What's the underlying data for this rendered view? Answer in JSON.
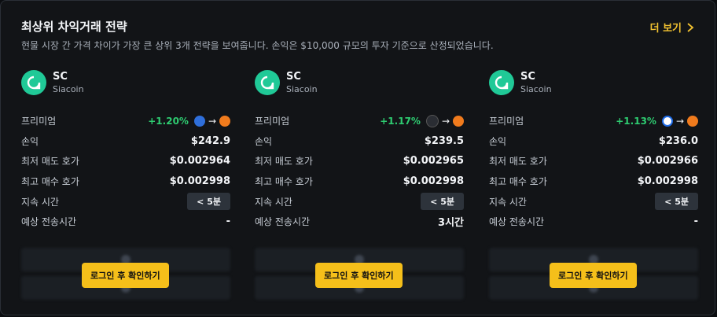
{
  "header": {
    "title": "최상위 차익거래 전략",
    "subtitle": "현물 시장 간 가격 차이가 가장 큰 상위 3개 전략을 보여줍니다. 손익은 $10,000 규모의 투자 기준으로 산정되었습니다.",
    "more_label": "더 보기"
  },
  "labels": {
    "premium": "프리미엄",
    "pnl": "손익",
    "lowest_ask": "최저 매도 호가",
    "highest_bid": "최고 매수 호가",
    "duration": "지속 시간",
    "transfer_time": "예상 전송시간",
    "login_button": "로그인 후 확인하기"
  },
  "cards": [
    {
      "symbol": "SC",
      "name": "Siacoin",
      "premium": "+1.20%",
      "from_exchange_icon": "mountain-exchange-icon",
      "to_exchange_icon": "orange-exchange-icon",
      "pnl": "$242.9",
      "lowest_ask": "$0.002964",
      "highest_bid": "$0.002998",
      "duration": "< 5분",
      "transfer_time": "-"
    },
    {
      "symbol": "SC",
      "name": "Siacoin",
      "premium": "+1.17%",
      "from_exchange_icon": "dark-exchange-icon",
      "to_exchange_icon": "orange-exchange-icon",
      "pnl": "$239.5",
      "lowest_ask": "$0.002965",
      "highest_bid": "$0.002998",
      "duration": "< 5분",
      "transfer_time": "3시간"
    },
    {
      "symbol": "SC",
      "name": "Siacoin",
      "premium": "+1.13%",
      "from_exchange_icon": "blue-exchange-icon",
      "to_exchange_icon": "orange-exchange-icon",
      "pnl": "$236.0",
      "lowest_ask": "$0.002966",
      "highest_bid": "$0.002998",
      "duration": "< 5분",
      "transfer_time": "-"
    }
  ],
  "colors": {
    "accent": "#f5bf1a",
    "positive": "#2ecc71",
    "coin": "#20c997"
  }
}
